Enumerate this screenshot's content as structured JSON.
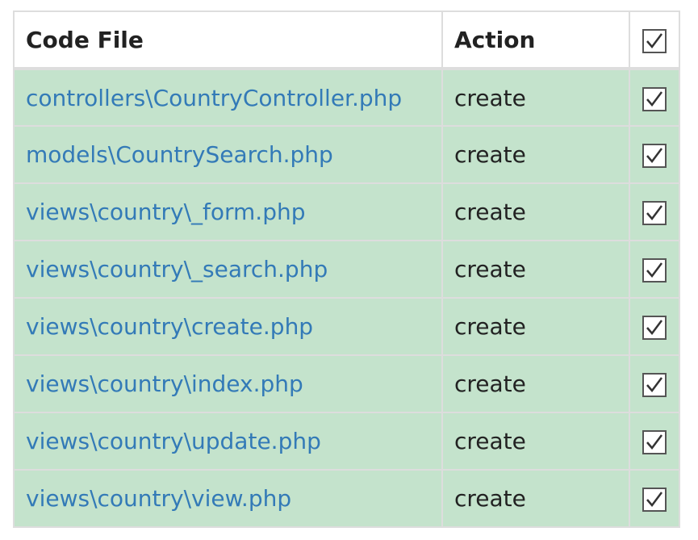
{
  "table": {
    "headers": {
      "code_file": "Code File",
      "action": "Action",
      "select_all_checked": true
    },
    "rows": [
      {
        "file": "controllers\\CountryController.php",
        "action": "create",
        "checked": true
      },
      {
        "file": "models\\CountrySearch.php",
        "action": "create",
        "checked": true
      },
      {
        "file": "views\\country\\_form.php",
        "action": "create",
        "checked": true
      },
      {
        "file": "views\\country\\_search.php",
        "action": "create",
        "checked": true
      },
      {
        "file": "views\\country\\create.php",
        "action": "create",
        "checked": true
      },
      {
        "file": "views\\country\\index.php",
        "action": "create",
        "checked": true
      },
      {
        "file": "views\\country\\update.php",
        "action": "create",
        "checked": true
      },
      {
        "file": "views\\country\\view.php",
        "action": "create",
        "checked": true
      }
    ]
  },
  "colors": {
    "row_background": "#c4e3cc",
    "link": "#337ab7",
    "border": "#dddddd",
    "text": "#222222"
  },
  "icons": {
    "checkbox": "checkbox-checked-icon"
  }
}
